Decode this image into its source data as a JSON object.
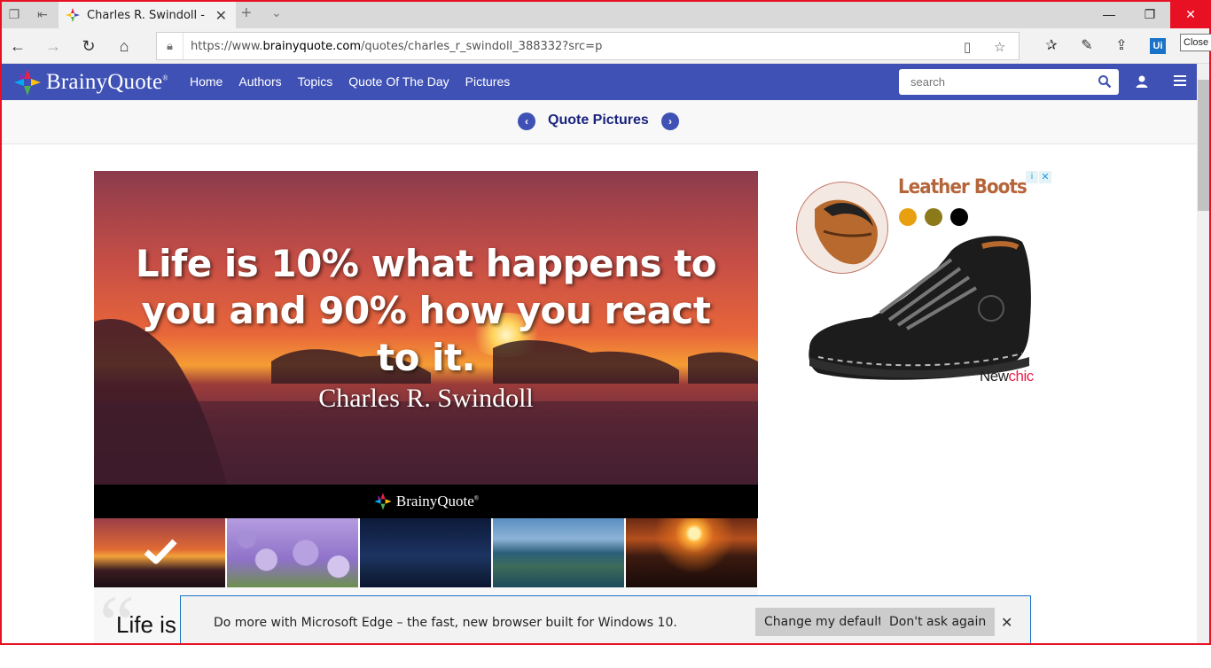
{
  "browser": {
    "tab_title": "Charles R. Swindoll - Life",
    "url_prefix": "https://www.",
    "url_domain": "brainyquote.com",
    "url_path": "/quotes/charles_r_swindoll_388332?src=p",
    "tooltip": "Close",
    "ui_badge": "Ui"
  },
  "site": {
    "logo_text": "BrainyQuote",
    "logo_mark": "®",
    "nav": [
      "Home",
      "Authors",
      "Topics",
      "Quote Of The Day",
      "Pictures"
    ],
    "search_placeholder": "search"
  },
  "subheader": {
    "title": "Quote Pictures"
  },
  "quote_image": {
    "text_lines": [
      "Life is 10% what happens to",
      "you and 90% how you react",
      "to it."
    ],
    "author": "Charles R. Swindoll",
    "footer_logo": "BrainyQuote",
    "footer_mark": "®"
  },
  "thumbnails": [
    "sunset-coast",
    "purple-crocus",
    "night-sky-hills",
    "coastal-cliffs",
    "orange-sunset"
  ],
  "ad": {
    "title": "Leather Boots",
    "color_options": [
      "#e8a010",
      "#8c7a1a",
      "#000000"
    ],
    "brand_prefix": "New",
    "brand_suffix": "chic",
    "info_label": "i",
    "close_label": "✕"
  },
  "quote_body": {
    "start": "Life is"
  },
  "notification": {
    "message": "Do more with Microsoft Edge – the fast, new browser built for Windows 10.",
    "primary_button": "Change my default",
    "secondary_button": "Don't ask again"
  },
  "colors": {
    "brand_blue": "#3f51b5",
    "edge_accent": "#1a73c9",
    "close_red": "#e81123"
  }
}
